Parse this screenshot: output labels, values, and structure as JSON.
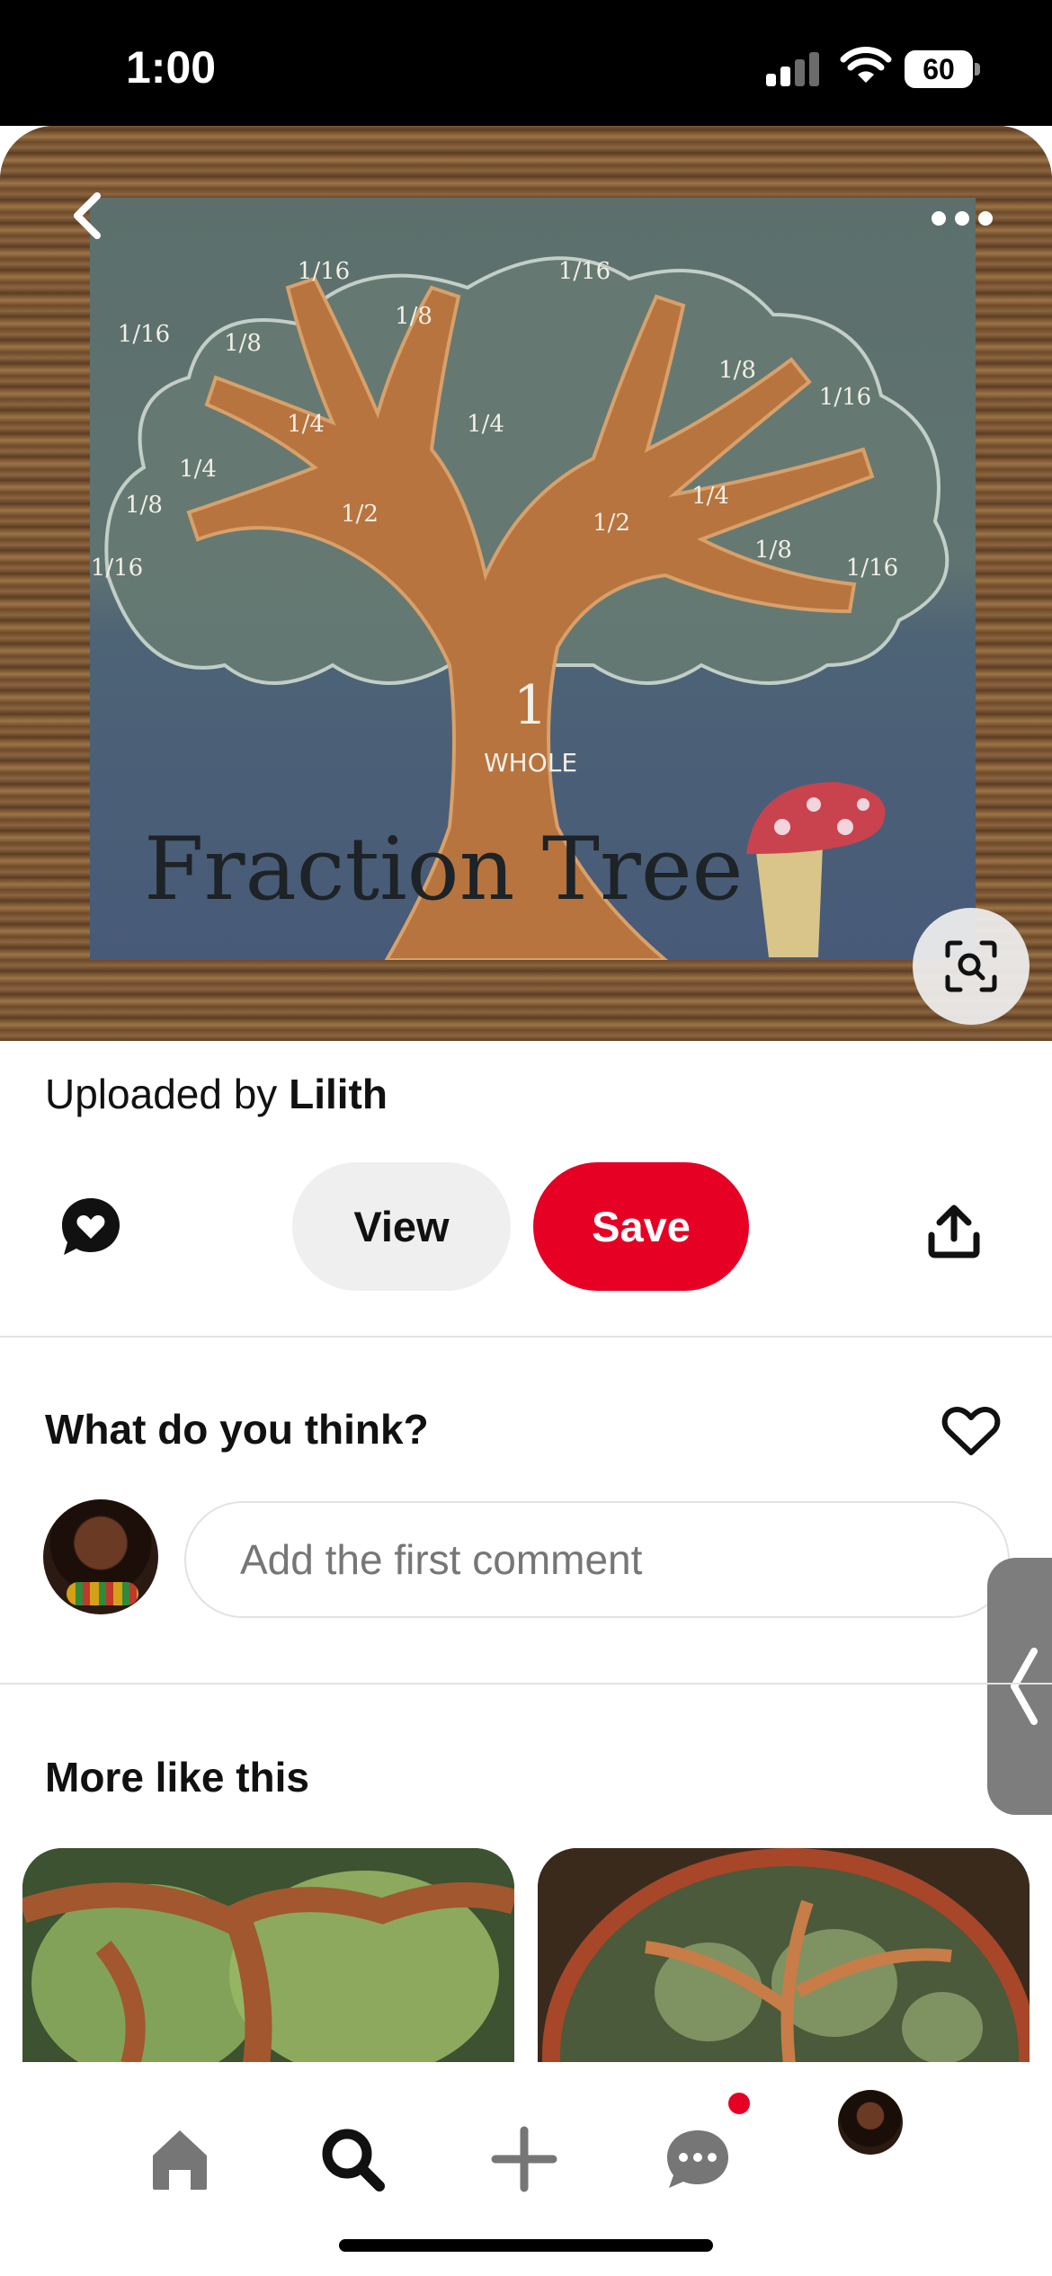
{
  "status_bar": {
    "time": "1:00",
    "battery": "60"
  },
  "hero": {
    "image_text": {
      "title": "Fraction Tree",
      "whole_number": "1",
      "whole_word": "WHOLE",
      "half": "1/2",
      "quarter": "1/4",
      "eighth": "1/8",
      "sixteenth": "1/16"
    },
    "back_icon": "chevron-left-icon",
    "more_icon": "more-dots-icon",
    "visual_search_icon": "lens-search-icon"
  },
  "pin": {
    "uploaded_by_label": "Uploaded by",
    "uploader_name": "Lilith"
  },
  "actions": {
    "view_label": "View",
    "save_label": "Save",
    "comment_icon": "speech-heart-icon",
    "share_icon": "share-upload-icon"
  },
  "comments": {
    "heading": "What do you think?",
    "placeholder": "Add the first comment",
    "like_icon": "heart-outline-icon"
  },
  "related": {
    "heading": "More like this"
  },
  "bottom_nav": {
    "items": [
      "home-icon",
      "search-icon",
      "create-plus-icon",
      "messages-icon",
      "profile-avatar"
    ],
    "active": "search-icon",
    "has_message_notification": true
  },
  "colors": {
    "brand_red": "#e60023",
    "view_button_bg": "#efefef",
    "nav_inactive": "#767676",
    "nav_active": "#111111"
  }
}
